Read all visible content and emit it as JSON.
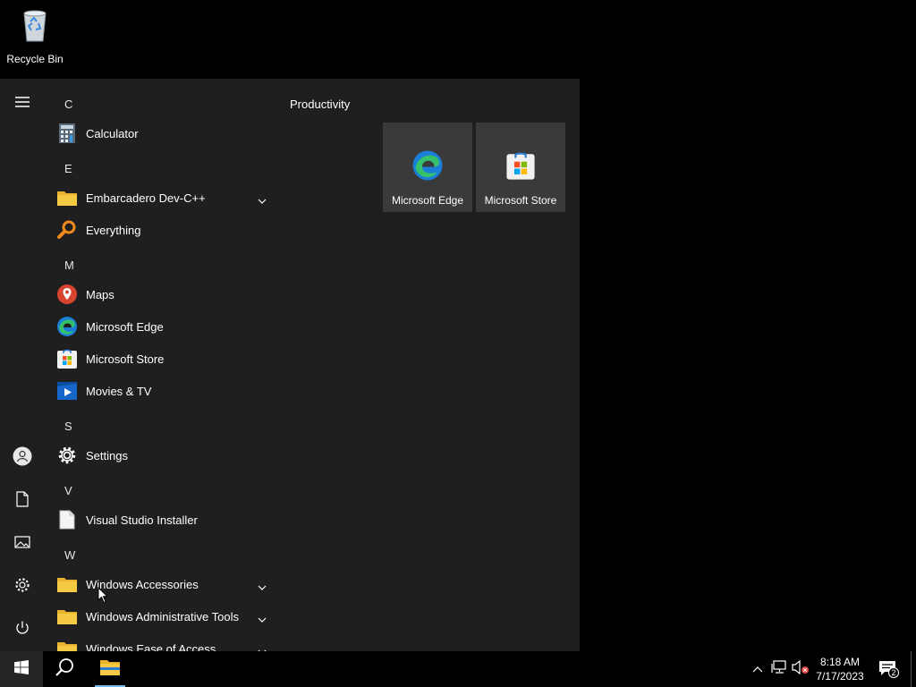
{
  "desktop": {
    "icons": [
      {
        "label": "Recycle Bin",
        "icon": "recycle-bin-icon"
      }
    ]
  },
  "start_menu": {
    "rail": [
      {
        "icon": "hamburger-menu-icon",
        "label": "Expand"
      },
      {
        "icon": "user-account-icon",
        "label": "Account"
      },
      {
        "icon": "documents-icon",
        "label": "Documents"
      },
      {
        "icon": "pictures-icon",
        "label": "Pictures"
      },
      {
        "icon": "settings-gear-icon",
        "label": "Settings"
      },
      {
        "icon": "power-icon",
        "label": "Power"
      }
    ],
    "letters": [
      "C",
      "E",
      "M",
      "S",
      "V",
      "W"
    ],
    "apps": [
      {
        "name": "Calculator",
        "icon": "calculator-icon"
      },
      {
        "name": "Embarcadero Dev-C++",
        "icon": "folder-icon",
        "expandable": true
      },
      {
        "name": "Everything",
        "icon": "magnifier-icon"
      },
      {
        "name": "Maps",
        "icon": "maps-pin-icon"
      },
      {
        "name": "Microsoft Edge",
        "icon": "edge-icon"
      },
      {
        "name": "Microsoft Store",
        "icon": "store-icon"
      },
      {
        "name": "Movies & TV",
        "icon": "movies-tv-icon"
      },
      {
        "name": "Settings",
        "icon": "gear-icon"
      },
      {
        "name": "Visual Studio Installer",
        "icon": "file-icon"
      },
      {
        "name": "Windows Accessories",
        "icon": "folder-icon",
        "expandable": true
      },
      {
        "name": "Windows Administrative Tools",
        "icon": "folder-icon",
        "expandable": true
      },
      {
        "name": "Windows Ease of Access",
        "icon": "folder-icon",
        "expandable": true
      }
    ],
    "tile_group": {
      "title": "Productivity",
      "tiles": [
        {
          "name": "Microsoft Edge",
          "icon": "edge-icon"
        },
        {
          "name": "Microsoft Store",
          "icon": "store-icon"
        }
      ]
    }
  },
  "taskbar": {
    "buttons": [
      {
        "icon": "windows-start-icon",
        "label": "Start"
      },
      {
        "icon": "search-icon",
        "label": "Search"
      },
      {
        "icon": "file-explorer-icon",
        "label": "File Explorer"
      }
    ],
    "tray": {
      "icons": [
        "chevron-up-icon",
        "network-icon",
        "volume-muted-icon"
      ],
      "time": "8:18 AM",
      "date": "7/17/2023",
      "notifications_count": "2"
    }
  },
  "colors": {
    "start_bg": "#1f1f1f",
    "tile_bg": "#3a3a3a",
    "taskbar_bg": "#000000",
    "accent": "#76b9ed"
  }
}
